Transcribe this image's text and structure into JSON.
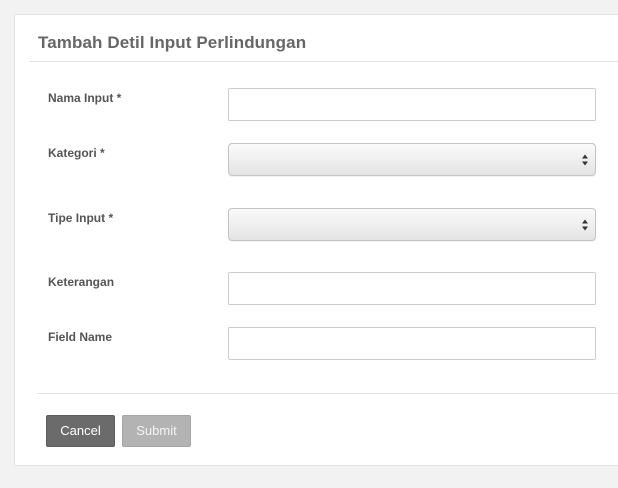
{
  "form": {
    "title": "Tambah Detil Input Perlindungan",
    "fields": [
      {
        "label": "Nama Input *",
        "type": "text",
        "value": "",
        "placeholder": ""
      },
      {
        "label": "Kategori *",
        "type": "select",
        "selected": ""
      },
      {
        "label": "Tipe Input *",
        "type": "select",
        "selected": ""
      },
      {
        "label": "Keterangan",
        "type": "text",
        "value": "",
        "placeholder": ""
      },
      {
        "label": "Field Name",
        "type": "text",
        "value": "",
        "placeholder": ""
      }
    ]
  },
  "actions": {
    "cancel_label": "Cancel",
    "submit_label": "Submit"
  },
  "colors": {
    "cancel_button": "#6b6b6b",
    "submit_button_disabled": "#b3b3b3",
    "title_text": "#666666"
  },
  "icons": {
    "select_arrow": "updown-chevron-icon"
  }
}
